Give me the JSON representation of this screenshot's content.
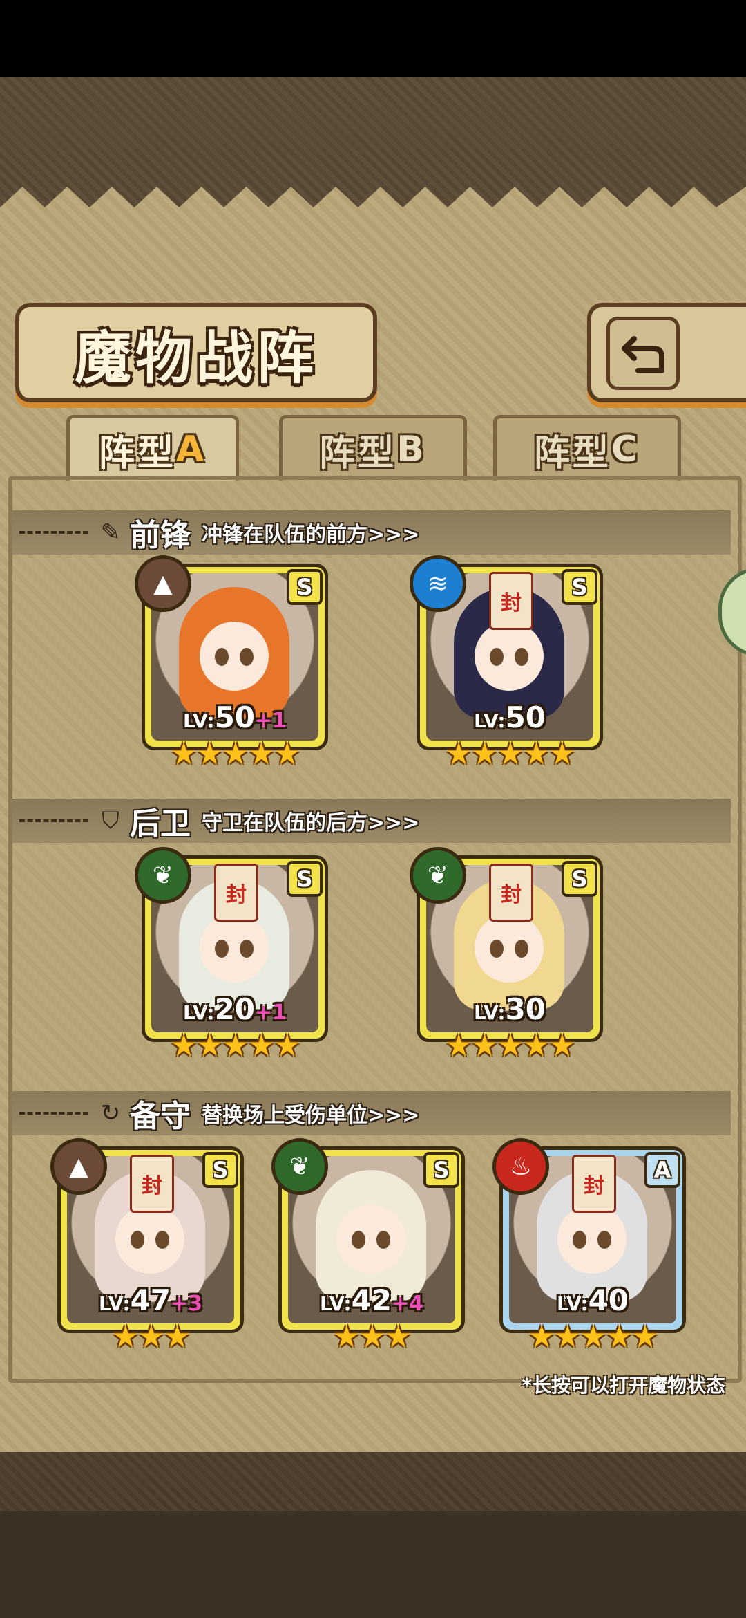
{
  "title": "魔物战阵",
  "back_icon": "return-arrow-icon",
  "tabs": [
    {
      "prefix": "阵型",
      "suffix": "A",
      "active": true
    },
    {
      "prefix": "阵型",
      "suffix": "B",
      "active": false
    },
    {
      "prefix": "阵型",
      "suffix": "C",
      "active": false
    }
  ],
  "sections": {
    "vanguard": {
      "icon": "feather-icon",
      "title": "前锋",
      "subtitle": "冲锋在队伍的前方>>>"
    },
    "rear": {
      "icon": "shield-icon",
      "title": "后卫",
      "subtitle": "守卫在队伍的后方>>>"
    },
    "reserve": {
      "icon": "swap-icon",
      "title": "备守",
      "subtitle": "替换场上受伤单位>>>"
    }
  },
  "cards": {
    "v1": {
      "rank": "S",
      "element": "mountain-icon",
      "element_color": "#6b4a38",
      "lv_label": "LV:",
      "level": "50",
      "bonus": "+1",
      "stars": 5,
      "stars_text": "★★★★★",
      "hair": "#e7762a"
    },
    "v2": {
      "rank": "S",
      "element": "water-icon",
      "element_color": "#1d7fd2",
      "lv_label": "LV:",
      "level": "50",
      "bonus": "",
      "stars": 5,
      "stars_text": "★★★★★",
      "hair": "#2a2a48"
    },
    "r1": {
      "rank": "S",
      "element": "leaf-icon",
      "element_color": "#2f6a2a",
      "lv_label": "LV:",
      "level": "20",
      "bonus": "+1",
      "stars": 5,
      "stars_text": "★★★★★",
      "hair": "#e8ece0"
    },
    "r2": {
      "rank": "S",
      "element": "leaf-icon",
      "element_color": "#2f6a2a",
      "lv_label": "LV:",
      "level": "30",
      "bonus": "",
      "stars": 5,
      "stars_text": "★★★★★",
      "hair": "#f0d890"
    },
    "b1": {
      "rank": "S",
      "element": "mountain-icon",
      "element_color": "#6b4a38",
      "lv_label": "LV:",
      "level": "47",
      "bonus": "+3",
      "stars": 3,
      "stars_text": "★★★",
      "hair": "#e8d8d0"
    },
    "b2": {
      "rank": "S",
      "element": "leaf-icon",
      "element_color": "#2f6a2a",
      "lv_label": "LV:",
      "level": "42",
      "bonus": "+4",
      "stars": 3,
      "stars_text": "★★★",
      "hair": "#f2ead8"
    },
    "b3": {
      "rank": "A",
      "element": "fire-icon",
      "element_color": "#c8281e",
      "lv_label": "LV:",
      "level": "40",
      "bonus": "",
      "stars": 5,
      "stars_text": "★★★★★",
      "hair": "#e0e0e0"
    }
  },
  "seal_char": "封",
  "footnote": "*长按可以打开魔物状态"
}
